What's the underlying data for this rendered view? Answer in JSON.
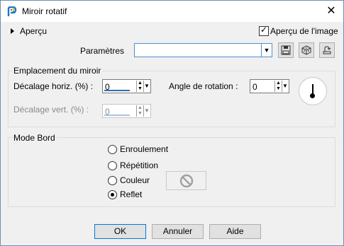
{
  "window": {
    "title": "Miroir rotatif",
    "close_glyph": "✕"
  },
  "preview": {
    "section_label": "Aperçu",
    "checkbox_label": "Aperçu de l'image",
    "checkbox_checked": true
  },
  "params": {
    "label": "Paramètres",
    "value": ""
  },
  "mirror_group": {
    "title": "Emplacement du miroir",
    "horiz_label": "Décalage horiz. (%) :",
    "horiz_value": "0",
    "vert_label": "Décalage vert. (%) :",
    "vert_value": "0",
    "angle_label": "Angle de rotation :",
    "angle_value": "0"
  },
  "edge_group": {
    "title": "Mode Bord",
    "options": [
      {
        "label": "Enroulement",
        "selected": false
      },
      {
        "label": "Répétition",
        "selected": false
      },
      {
        "label": "Couleur",
        "selected": false
      },
      {
        "label": "Reflet",
        "selected": true
      }
    ]
  },
  "buttons": {
    "ok": "OK",
    "cancel": "Annuler",
    "help": "Aide"
  },
  "colors": {
    "accent": "#0078d7",
    "spin_line": "#2e6db4"
  }
}
